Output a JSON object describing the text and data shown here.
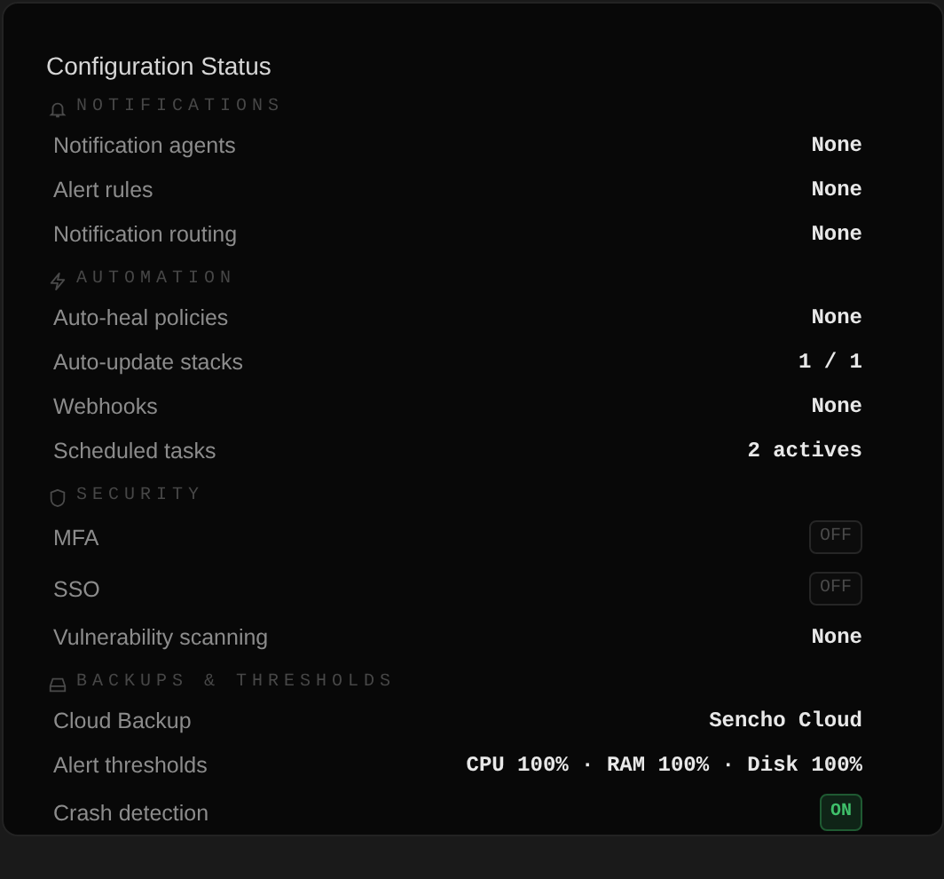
{
  "title": "Configuration Status",
  "sections": [
    {
      "kind": "bell",
      "label": "NOTIFICATIONS",
      "rows": [
        {
          "label": "Notification agents",
          "kind": "text",
          "value": "None"
        },
        {
          "label": "Alert rules",
          "kind": "text",
          "value": "None"
        },
        {
          "label": "Notification routing",
          "kind": "text",
          "value": "None"
        }
      ]
    },
    {
      "kind": "bolt",
      "label": "AUTOMATION",
      "rows": [
        {
          "label": "Auto-heal policies",
          "kind": "text",
          "value": "None"
        },
        {
          "label": "Auto-update stacks",
          "kind": "text",
          "value": "1 / 1"
        },
        {
          "label": "Webhooks",
          "kind": "text",
          "value": "None"
        },
        {
          "label": "Scheduled tasks",
          "kind": "text",
          "value": "2 actives"
        }
      ]
    },
    {
      "kind": "shield",
      "label": "SECURITY",
      "rows": [
        {
          "label": "MFA",
          "kind": "toggle",
          "value": "OFF",
          "on": false
        },
        {
          "label": "SSO",
          "kind": "toggle",
          "value": "OFF",
          "on": false
        },
        {
          "label": "Vulnerability scanning",
          "kind": "text",
          "value": "None"
        }
      ]
    },
    {
      "kind": "drive",
      "label": "BACKUPS & THRESHOLDS",
      "rows": [
        {
          "label": "Cloud Backup",
          "kind": "text",
          "value": "Sencho Cloud"
        },
        {
          "label": "Alert thresholds",
          "kind": "text",
          "value": "CPU 100% · RAM 100% · Disk 100%"
        },
        {
          "label": "Crash detection",
          "kind": "toggle",
          "value": "ON",
          "on": true
        }
      ]
    }
  ]
}
